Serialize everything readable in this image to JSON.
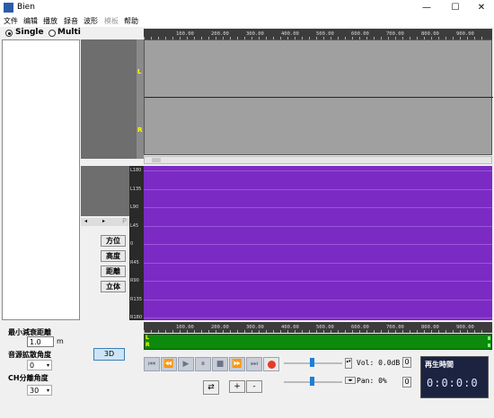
{
  "window": {
    "title": "Bien",
    "minimize": "—",
    "maximize": "☐",
    "close": "✕"
  },
  "menu": {
    "items": [
      "文件",
      "编辑",
      "播放",
      "録音",
      "波形",
      "模板",
      "帮助"
    ]
  },
  "mode": {
    "single_label": "Single",
    "multi_label": "Multi",
    "selected": "Single"
  },
  "ruler": {
    "labels": [
      "100.00",
      "200.00",
      "300.00",
      "400.00",
      "500.00",
      "600.00",
      "700.00",
      "800.00",
      "900.00"
    ]
  },
  "channels": {
    "left": "L",
    "right": "R"
  },
  "spectrum_scale": {
    "labels": [
      "L180",
      "L135",
      "L90",
      "L45",
      "0",
      "R45",
      "R90",
      "R135",
      "R180"
    ]
  },
  "mini_scroll": {
    "p_label": "P"
  },
  "panel_buttons": {
    "azimuth": "方位",
    "height": "高度",
    "distance": "距離",
    "stereo": "立体"
  },
  "settings": {
    "min_attenuation_label": "最小減衰距離",
    "min_attenuation_value": "1.0",
    "min_attenuation_unit": "m",
    "spread_label": "音源拡散角度",
    "spread_value": "0",
    "ch_sep_label": "CH分離角度",
    "ch_sep_value": "30"
  },
  "buttons": {
    "three_d": "3D",
    "plus": "+",
    "minus": "-",
    "loop": "⇄"
  },
  "transport": {
    "icons": [
      "⏮",
      "⏪",
      "▶",
      "⏸",
      "■",
      "⏩",
      "⏭"
    ]
  },
  "volume": {
    "label": "Vol: 0.0dB",
    "value_box": "0"
  },
  "pan": {
    "label": "Pan: 0%",
    "value_box": "0"
  },
  "playback_time": {
    "title": "再生時間",
    "value": "0:0:0:0"
  }
}
